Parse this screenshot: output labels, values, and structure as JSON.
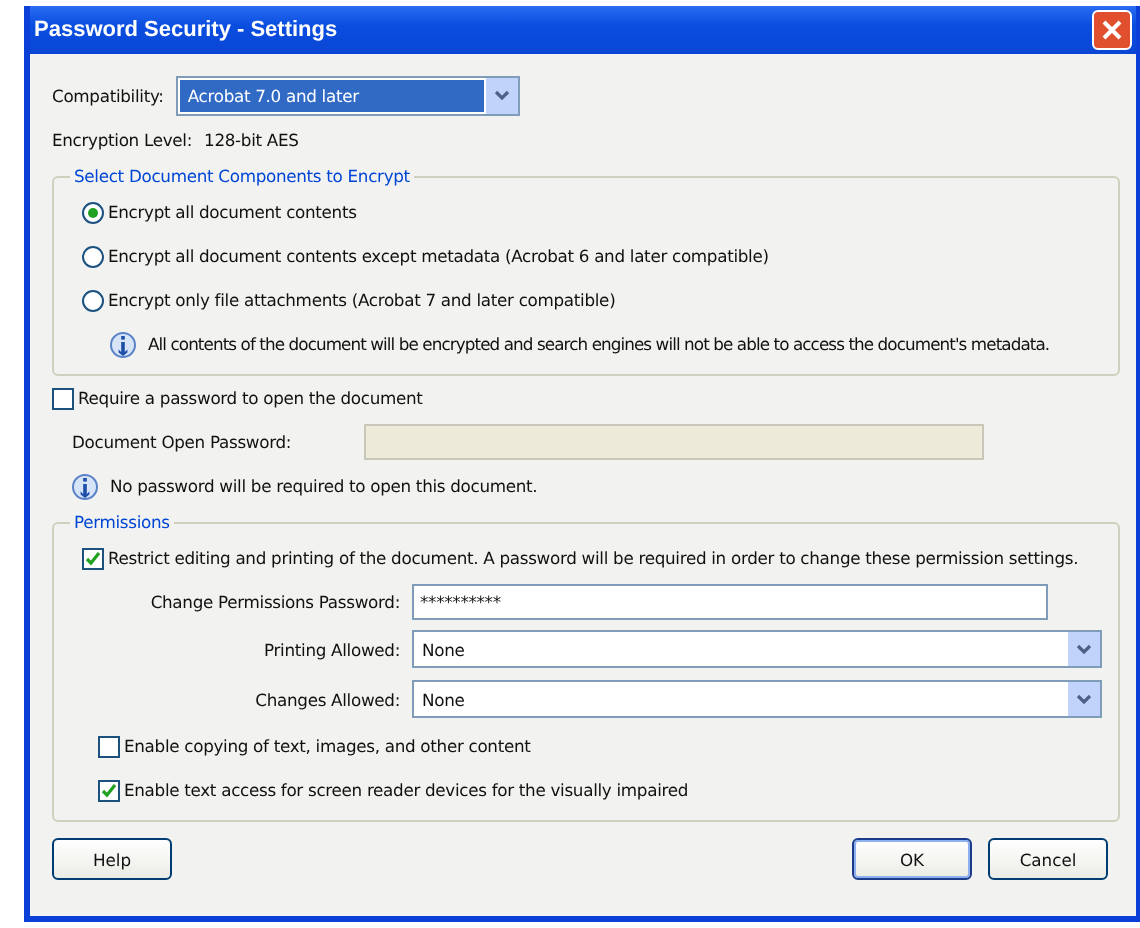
{
  "window": {
    "title": "Password Security - Settings"
  },
  "compatibility": {
    "label": "Compatibility:",
    "value": "Acrobat 7.0 and later"
  },
  "encryption_level": {
    "label": "Encryption Level:",
    "value": "128-bit AES"
  },
  "encrypt_group": {
    "legend": "Select Document Components to Encrypt",
    "options": [
      {
        "label": "Encrypt all document contents",
        "selected": true
      },
      {
        "label": "Encrypt all document contents except metadata (Acrobat 6 and later compatible)",
        "selected": false
      },
      {
        "label": "Encrypt only file attachments (Acrobat 7 and later compatible)",
        "selected": false
      }
    ],
    "info": "All contents of the document will be encrypted and search engines will not be able to access the document's metadata."
  },
  "require_open_password": {
    "label": "Require a password to open the document",
    "checked": false
  },
  "open_password": {
    "label": "Document Open Password:",
    "disabled": true
  },
  "open_info": "No password will be required to open this document.",
  "permissions": {
    "legend": "Permissions",
    "restrict": {
      "label": "Restrict editing and printing of the document. A password will be required in order to change these permission settings.",
      "checked": true
    },
    "change_password": {
      "label": "Change Permissions Password:",
      "value": "**********"
    },
    "selects": [
      {
        "label": "Printing Allowed:",
        "value": "None"
      },
      {
        "label": "Changes Allowed:",
        "value": "None"
      }
    ],
    "checkboxes": [
      {
        "label": "Enable copying of text, images, and other content",
        "checked": false
      },
      {
        "label": "Enable text access for screen reader devices for the visually impaired",
        "checked": true
      }
    ]
  },
  "help_button": {
    "label": "Help"
  },
  "buttons": [
    {
      "label": "OK",
      "default": true
    },
    {
      "label": "Cancel",
      "default": false
    }
  ]
}
